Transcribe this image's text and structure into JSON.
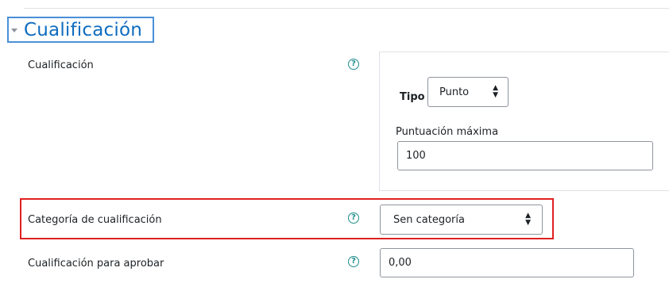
{
  "section": {
    "title": "Cualificación"
  },
  "grade": {
    "label": "Cualificación",
    "type_label": "Tipo",
    "type_value": "Punto",
    "max_label": "Puntuación máxima",
    "max_value": "100"
  },
  "category": {
    "label": "Categoría de cualificación",
    "value": "Sen categoría"
  },
  "pass": {
    "label": "Cualificación para aprobar",
    "value": "0,00"
  },
  "help_glyph": "?",
  "colors": {
    "title": "#0f6cbf",
    "help": "#208b8b",
    "highlight": "#e02020",
    "header_border": "#4a90d9"
  }
}
